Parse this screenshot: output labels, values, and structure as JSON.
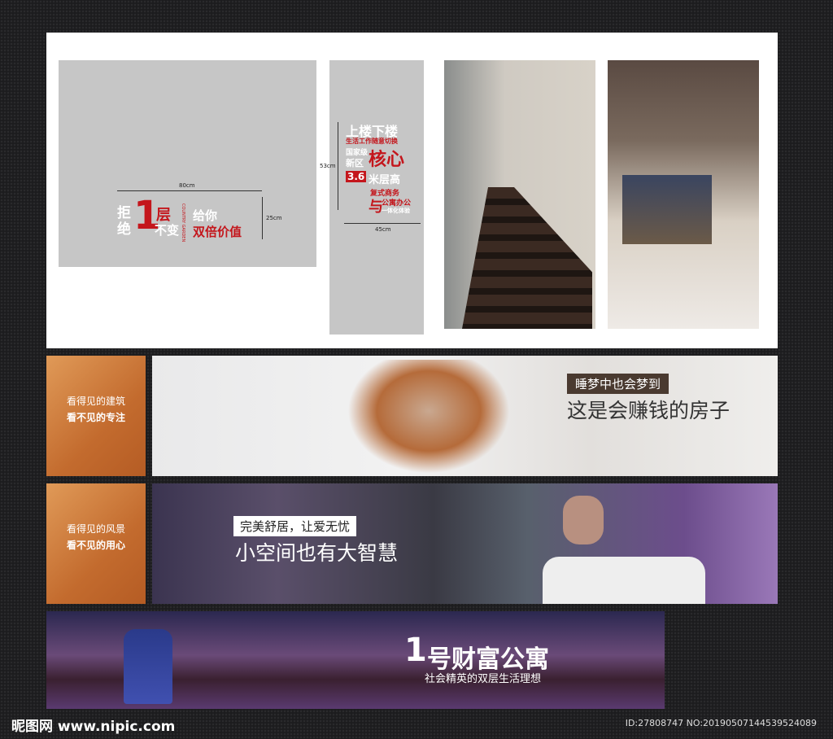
{
  "panel1": {
    "width_label": "80cm",
    "height_label": "25cm",
    "slogan_a": "拒绝",
    "slogan_num": "1",
    "slogan_b": "层",
    "slogan_c": "不变",
    "slogan_d": "给你",
    "slogan_e": "双倍价值",
    "brand": "COUNTRY GARDEN"
  },
  "panel2": {
    "height_label": "53cm",
    "width_label": "45cm",
    "line1": "上楼下楼",
    "line2": "生活工作随意切换",
    "line3": "国家级",
    "line4": "新区",
    "line5": "核心",
    "line6": "3.6",
    "line7": "米层高",
    "line8": "复式商务",
    "line9": "与",
    "line10": "公寓办公",
    "line11": "一体化体验"
  },
  "banner1": {
    "side_a": "看得见的建筑",
    "side_b": "看不见的专注",
    "tag": "睡梦中也会梦到",
    "headline": "这是会赚钱的房子"
  },
  "banner2": {
    "side_a": "看得见的风景",
    "side_b": "看不见的用心",
    "tag": "完美舒居，让爱无忧",
    "headline": "小空间也有大智慧"
  },
  "banner3": {
    "title_num": "1",
    "title": "号财富公寓",
    "subtitle": "社会精英的双层生活理想"
  },
  "footer": {
    "logo": "昵图网 www.nipic.com",
    "id": "ID:27808747 NO:20190507144539524089"
  }
}
